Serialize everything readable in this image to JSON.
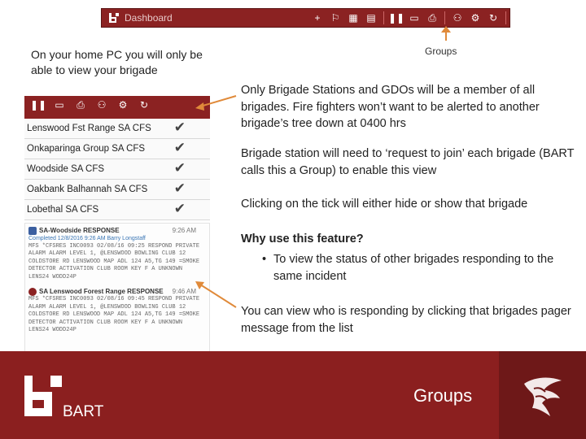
{
  "topbar": {
    "title": "Dashboard",
    "icons": [
      "plus-icon",
      "chat-icon",
      "calendar-icon",
      "calendar-date-icon",
      "pause-icon",
      "message-icon",
      "printer-icon",
      "users-icon",
      "gear-icon",
      "refresh-icon"
    ]
  },
  "groups_callout": "Groups",
  "home_pc_note": "On your home PC you will only be able to view your brigade",
  "panel": {
    "brigades": [
      "Lenswood Fst Range SA CFS",
      "Onkaparinga Group SA CFS",
      "Woodside SA CFS",
      "Oakbank Balhannah SA CFS",
      "Lobethal SA CFS"
    ]
  },
  "messages": [
    {
      "title": "SA-Woodside RESPONSE",
      "time": "9:26 AM",
      "sub": "Completed 12/8/2016 9:26 AM  Barry Longstaff",
      "body": "MFS *CFSRES INC0093 02/08/16 09:25 RESPOND PRIVATE ALARM ALARM LEVEL 1, @LENSWOOD BOWLING CLUB 12 COLDSTORE RD LENSWOOD MAP ADL 124 A5,TG 149 =SMOKE DETECTOR ACTIVATION CLUB ROOM KEY F A UNKNOWN LENS24 WODD24P"
    },
    {
      "title": "SA Lenswood Forest Range RESPONSE",
      "time": "9:46 AM",
      "sub": "",
      "body": "MFS *CFSRES INC0093 02/08/16 09:45 RESPOND PRIVATE ALARM ALARM LEVEL 1, @LENSWOOD BOWLING CLUB 12 COLDSTORE RD LENSWOOD MAP ADL 124 A5,TG 149 =SMOKE DETECTOR ACTIVATION CLUB ROOM KEY F A UNKNOWN LENS24 WODD24P"
    }
  ],
  "text": {
    "membership": "Only Brigade Stations and GDOs will be a member of all brigades. Fire fighters won’t want to be alerted to another brigade’s tree down at 0400 hrs",
    "request_join": "Brigade station will need to ‘request to join’ each brigade (BART calls this a Group) to enable this view",
    "tick_toggle": "Clicking on the tick will either hide or show that brigade",
    "why_heading": "Why use this feature?",
    "why_bullet": "To view the status of other brigades responding to the same incident",
    "view_responding": "You can view who is responding by clicking that brigades pager message from the list"
  },
  "footer": {
    "brand": "BART",
    "section_title": "Groups"
  },
  "colors": {
    "brand_red": "#8b2222",
    "footer_red": "#8b1f1f",
    "arrow_orange": "#e08a3a"
  }
}
